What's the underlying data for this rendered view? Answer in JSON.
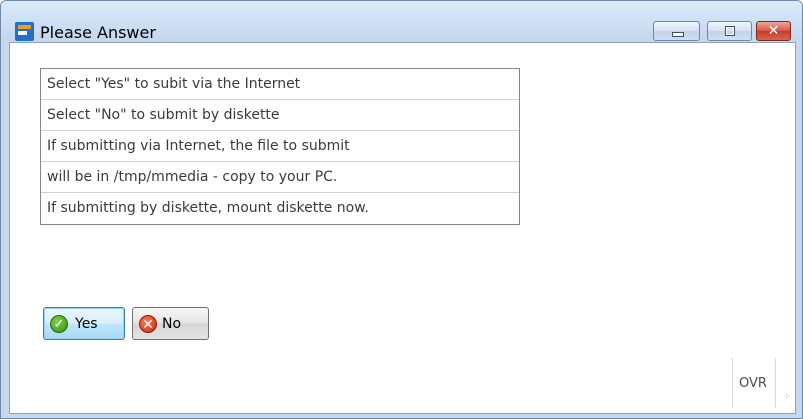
{
  "window": {
    "title": "Please Answer",
    "app_icon": "app-logo-icon",
    "controls": {
      "minimize_icon": "minimize-icon",
      "maximize_icon": "maximize-icon",
      "close_icon": "close-icon",
      "close_glyph": "✕"
    }
  },
  "message_lines": [
    "Select \"Yes\" to subit via the Internet",
    "Select \"No\" to submit by diskette",
    "If submitting via Internet, the file to submit",
    "will be in /tmp/mmedia - copy to your PC.",
    "If submitting by diskette, mount diskette now."
  ],
  "buttons": {
    "yes": {
      "label": "Yes",
      "icon": "check-icon",
      "icon_glyph": "✓"
    },
    "no": {
      "label": "No",
      "icon": "cross-icon",
      "icon_glyph": "✕"
    }
  },
  "status": {
    "mode": "OVR",
    "grip_glyph": "⁘"
  },
  "colors": {
    "title_bar": "#c6d9ef",
    "close_button": "#c33d2e",
    "default_button_border": "#3c7fb1"
  }
}
